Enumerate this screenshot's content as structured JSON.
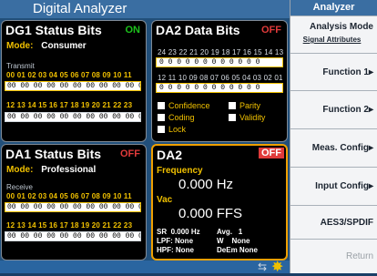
{
  "header": {
    "title": "Digital Analyzer"
  },
  "dg1": {
    "title": "DG1  Status Bits",
    "state": "ON",
    "mode_label": "Mode:",
    "mode_value": "Consumer",
    "section": "Transmit",
    "row1_nums": "00 01 02 03 04 05 06 07 08 09 10 11",
    "row1_bits": "00 00 00 00 00 00 00 00 00 00 00 00",
    "row2_nums": "12 13 14 15 16 17 18 19 20 21 22 23",
    "row2_bits": "00 00 00 00 00 00 00 00 00 00 00 00"
  },
  "dg2": {
    "title": "DA2  Data  Bits",
    "state": "OFF",
    "nums1": "24 23 22 21 20 19 18 17 16 15 14 13",
    "bits1": "0  0  0  0  0  0  0  0  0  0  0  0",
    "nums2": "12 11 10 09 08 07 06 05 04 03 02 01",
    "bits2": "0  0  0  0  0  0  0  0  0  0  0  0",
    "flags": {
      "confidence": "Confidence",
      "parity": "Parity",
      "coding": "Coding",
      "validity": "Validity",
      "lock": "Lock"
    }
  },
  "da1": {
    "title": "DA1  Status Bits",
    "state": "OFF",
    "mode_label": "Mode:",
    "mode_value": "Professional",
    "section": "Receive",
    "row1_nums": "00 01 02 03 04 05 06 07 08 09 10 11",
    "row1_bits": "00 00 00 00 00 00 00 00 00 00 00 00",
    "row2_nums": "12 13 14 15 16 17 18 19 20 21 22 23",
    "row2_bits": "00 00 00 00 00 00 00 00 00 00 00 00"
  },
  "da2": {
    "title": "DA2",
    "state": "OFF",
    "freq_label": "Frequency",
    "freq_value": "0.000 Hz",
    "vac_label": "Vac",
    "vac_value": "0.000 FFS",
    "sr_label": "SR",
    "sr_value": "0.000 Hz",
    "avg_label": "Avg.",
    "avg_value": "1",
    "lpf_label": "LPF:",
    "lpf_value": "None",
    "w_label": "W",
    "w_value": "None",
    "hpf_label": "HPF:",
    "hpf_value": "None",
    "deem_label": "DeEm",
    "deem_value": "None"
  },
  "sidebar": {
    "title": "Analyzer",
    "buttons": [
      {
        "label": "Analysis Mode",
        "sub": "Signal Attributes"
      },
      {
        "label": "Function 1▸"
      },
      {
        "label": "Function 2▸"
      },
      {
        "label": "Meas. Config▸"
      },
      {
        "label": "Input Config▸"
      },
      {
        "label": "AES3/SPDIF Config▸"
      },
      {
        "label": "Return"
      }
    ]
  },
  "status_icons": {
    "usb": "usb-icon",
    "star": "star-icon"
  },
  "colors": {
    "accent": "#f0c000",
    "on": "#1cc21c",
    "off": "#e03a3a",
    "panel_bg": "#000000",
    "frame": "#214f7a"
  }
}
